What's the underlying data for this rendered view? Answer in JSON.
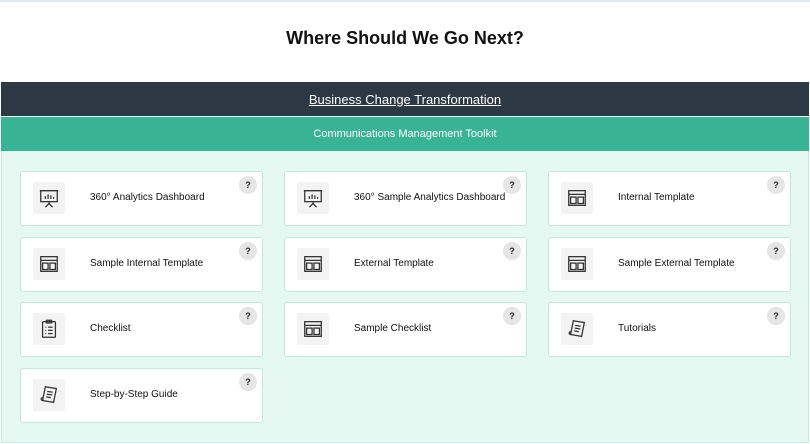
{
  "page": {
    "title": "Where Should We Go Next?"
  },
  "breadcrumb": {
    "parent": "Business Change Transformation",
    "current": "Communications Management Toolkit"
  },
  "cards": [
    {
      "label": "360° Analytics Dashboard",
      "icon": "presentation-chart-icon",
      "help": "?"
    },
    {
      "label": "360° Sample Analytics Dashboard",
      "icon": "presentation-chart-icon",
      "help": "?"
    },
    {
      "label": "Internal Template",
      "icon": "template-layout-icon",
      "help": "?"
    },
    {
      "label": "Sample Internal Template",
      "icon": "template-layout-icon",
      "help": "?"
    },
    {
      "label": "External Template",
      "icon": "template-layout-icon",
      "help": "?"
    },
    {
      "label": "Sample External Template",
      "icon": "template-layout-icon",
      "help": "?"
    },
    {
      "label": "Checklist",
      "icon": "clipboard-checklist-icon",
      "help": "?"
    },
    {
      "label": "Sample Checklist",
      "icon": "template-layout-icon",
      "help": "?"
    },
    {
      "label": "Tutorials",
      "icon": "scroll-document-icon",
      "help": "?"
    },
    {
      "label": "Step-by-Step Guide",
      "icon": "scroll-document-icon",
      "help": "?"
    }
  ],
  "colors": {
    "dark_bar": "#2c3945",
    "accent_green": "#38b393",
    "panel_bg": "#e5f8f1",
    "card_border": "#bfe9da"
  }
}
